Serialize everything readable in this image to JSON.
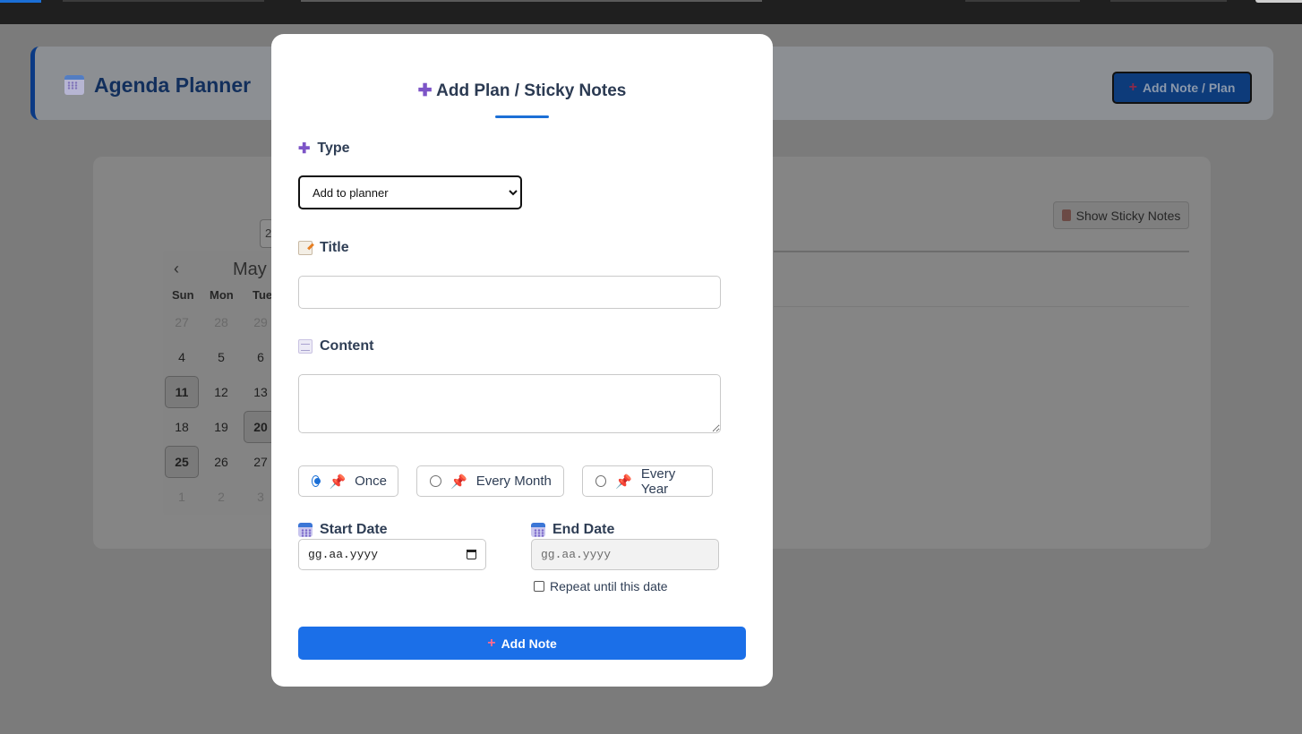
{
  "app": {
    "title": "Agenda Planner",
    "header_button_label": "Add Note / Plan",
    "sticky_button_label": "Show Sticky Notes",
    "year_partial": "2"
  },
  "calendar": {
    "month": "May",
    "weekdays": [
      "Sun",
      "Mon",
      "Tue"
    ],
    "weeks": [
      [
        {
          "d": "27",
          "muted": true
        },
        {
          "d": "28",
          "muted": true
        },
        {
          "d": "29",
          "muted": true
        }
      ],
      [
        {
          "d": "4"
        },
        {
          "d": "5"
        },
        {
          "d": "6"
        }
      ],
      [
        {
          "d": "11",
          "hl": true
        },
        {
          "d": "12"
        },
        {
          "d": "13"
        }
      ],
      [
        {
          "d": "18"
        },
        {
          "d": "19"
        },
        {
          "d": "20",
          "hl": true
        }
      ],
      [
        {
          "d": "25",
          "hl": true
        },
        {
          "d": "26"
        },
        {
          "d": "27"
        }
      ],
      [
        {
          "d": "1",
          "muted": true
        },
        {
          "d": "2",
          "muted": true
        },
        {
          "d": "3",
          "muted": true
        }
      ]
    ]
  },
  "modal": {
    "title": "Add Plan / Sticky Notes",
    "type_label": "Type",
    "type_selected": "Add to planner",
    "title_label": "Title",
    "title_value": "",
    "content_label": "Content",
    "content_value": "",
    "recurrence": [
      {
        "label": "Once",
        "checked": true
      },
      {
        "label": "Every Month",
        "checked": false
      },
      {
        "label": "Every Year",
        "checked": false
      }
    ],
    "start_date_label": "Start Date",
    "start_date_placeholder": "gg.aa.yyyy",
    "end_date_label": "End Date",
    "end_date_placeholder": "gg.aa.yyyy",
    "repeat_until_label": "Repeat until this date",
    "submit_label": "Add Note"
  },
  "colors": {
    "accent": "#1b6fe8",
    "overlay": "#7b7b7b",
    "pin": "#d0365b",
    "plus": "#7d55c7"
  }
}
